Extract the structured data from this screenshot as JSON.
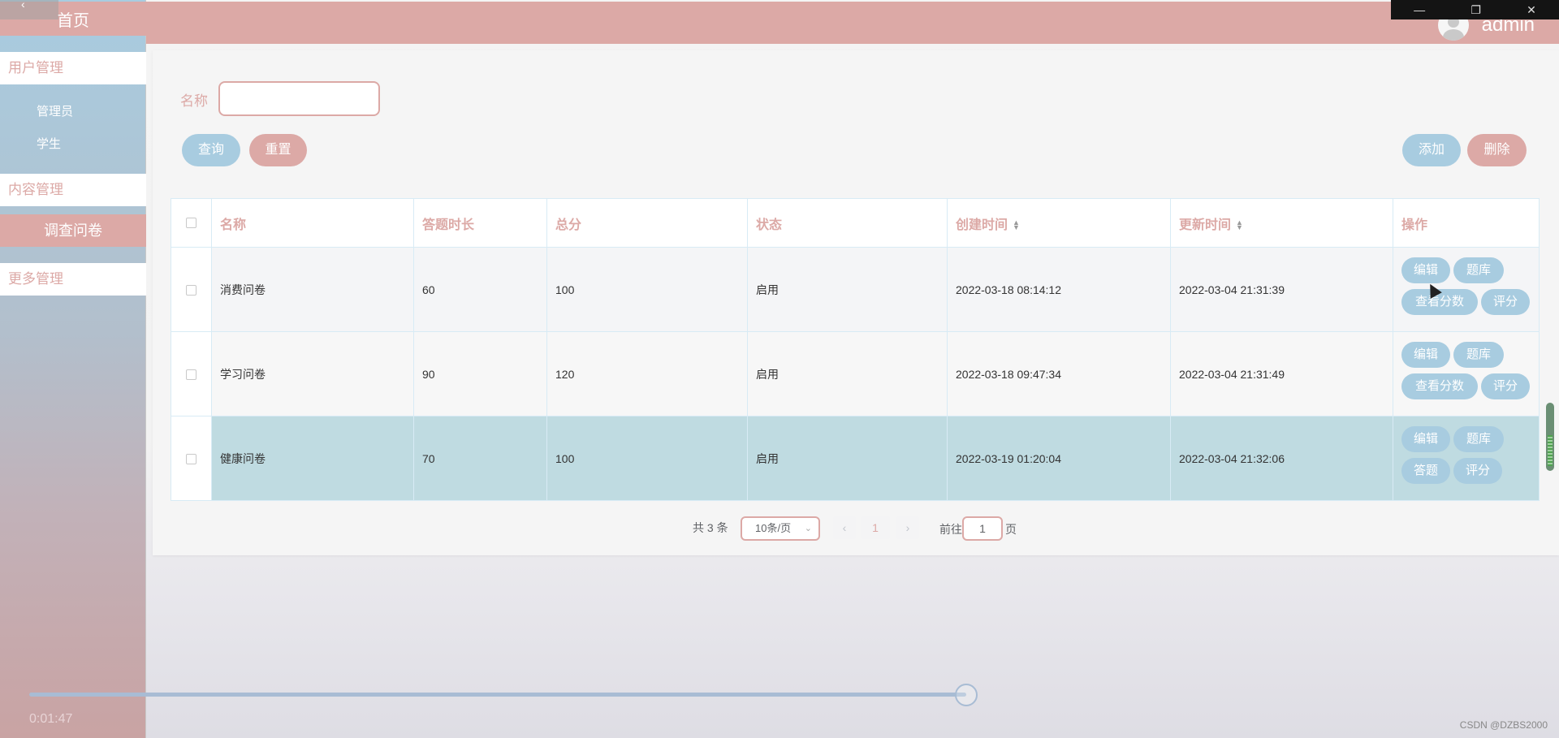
{
  "window": {
    "back_icon": "chevron-left-icon",
    "controls": [
      "minimize-icon",
      "restore-icon",
      "close-icon"
    ]
  },
  "header": {
    "username": "admin",
    "avatar_icon": "user-avatar-icon"
  },
  "sidebar": {
    "home": "首页",
    "groups": [
      {
        "label": "用户管理",
        "items": [
          "管理员",
          "学生"
        ]
      },
      {
        "label": "内容管理",
        "active_item": "调查问卷"
      },
      {
        "label": "更多管理"
      }
    ]
  },
  "search": {
    "label": "名称",
    "value": "",
    "placeholder": ""
  },
  "buttons": {
    "query": "查询",
    "reset": "重置",
    "add": "添加",
    "delete": "删除"
  },
  "table": {
    "columns": [
      "名称",
      "答题时长",
      "总分",
      "状态",
      "创建时间",
      "更新时间",
      "操作"
    ],
    "rows": [
      {
        "name": "消费问卷",
        "duration": "60",
        "score": "100",
        "status": "启用",
        "created": "2022-03-18 08:14:12",
        "updated": "2022-03-04 21:31:39",
        "ops": [
          "编辑",
          "题库",
          "查看分数",
          "评分"
        ]
      },
      {
        "name": "学习问卷",
        "duration": "90",
        "score": "120",
        "status": "启用",
        "created": "2022-03-18 09:47:34",
        "updated": "2022-03-04 21:31:49",
        "ops": [
          "编辑",
          "题库",
          "查看分数",
          "评分"
        ]
      },
      {
        "name": "健康问卷",
        "duration": "70",
        "score": "100",
        "status": "启用",
        "created": "2022-03-19 01:20:04",
        "updated": "2022-03-04 21:32:06",
        "ops": [
          "编辑",
          "题库",
          "答题",
          "评分"
        ]
      }
    ]
  },
  "pagination": {
    "total": "共 3 条",
    "page_size": "10条/页",
    "current_page": "1",
    "jump_label": "前往",
    "jump_value": "1",
    "jump_suffix": "页"
  },
  "video": {
    "time": "0:01:47",
    "progress": 0.84
  },
  "watermark": "CSDN @DZBS2000",
  "colors": {
    "accent_pink": "#dca9a6",
    "accent_blue": "#a8cce0",
    "highlight_row": "#bfdbe1"
  }
}
